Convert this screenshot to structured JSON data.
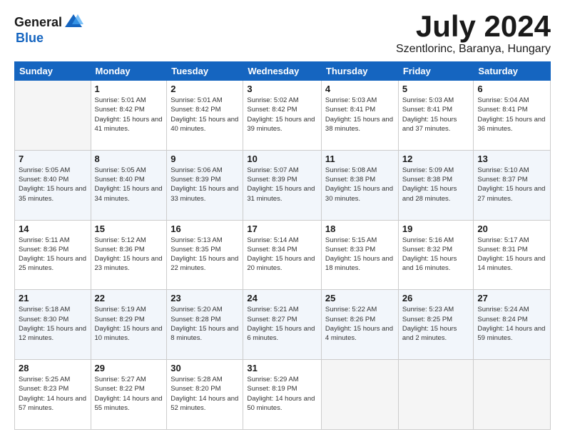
{
  "logo": {
    "general": "General",
    "blue": "Blue"
  },
  "header": {
    "month": "July 2024",
    "location": "Szentlorinc, Baranya, Hungary"
  },
  "weekdays": [
    "Sunday",
    "Monday",
    "Tuesday",
    "Wednesday",
    "Thursday",
    "Friday",
    "Saturday"
  ],
  "weeks": [
    [
      {
        "day": "",
        "sunrise": "",
        "sunset": "",
        "daylight": ""
      },
      {
        "day": "1",
        "sunrise": "Sunrise: 5:01 AM",
        "sunset": "Sunset: 8:42 PM",
        "daylight": "Daylight: 15 hours and 41 minutes."
      },
      {
        "day": "2",
        "sunrise": "Sunrise: 5:01 AM",
        "sunset": "Sunset: 8:42 PM",
        "daylight": "Daylight: 15 hours and 40 minutes."
      },
      {
        "day": "3",
        "sunrise": "Sunrise: 5:02 AM",
        "sunset": "Sunset: 8:42 PM",
        "daylight": "Daylight: 15 hours and 39 minutes."
      },
      {
        "day": "4",
        "sunrise": "Sunrise: 5:03 AM",
        "sunset": "Sunset: 8:41 PM",
        "daylight": "Daylight: 15 hours and 38 minutes."
      },
      {
        "day": "5",
        "sunrise": "Sunrise: 5:03 AM",
        "sunset": "Sunset: 8:41 PM",
        "daylight": "Daylight: 15 hours and 37 minutes."
      },
      {
        "day": "6",
        "sunrise": "Sunrise: 5:04 AM",
        "sunset": "Sunset: 8:41 PM",
        "daylight": "Daylight: 15 hours and 36 minutes."
      }
    ],
    [
      {
        "day": "7",
        "sunrise": "Sunrise: 5:05 AM",
        "sunset": "Sunset: 8:40 PM",
        "daylight": "Daylight: 15 hours and 35 minutes."
      },
      {
        "day": "8",
        "sunrise": "Sunrise: 5:05 AM",
        "sunset": "Sunset: 8:40 PM",
        "daylight": "Daylight: 15 hours and 34 minutes."
      },
      {
        "day": "9",
        "sunrise": "Sunrise: 5:06 AM",
        "sunset": "Sunset: 8:39 PM",
        "daylight": "Daylight: 15 hours and 33 minutes."
      },
      {
        "day": "10",
        "sunrise": "Sunrise: 5:07 AM",
        "sunset": "Sunset: 8:39 PM",
        "daylight": "Daylight: 15 hours and 31 minutes."
      },
      {
        "day": "11",
        "sunrise": "Sunrise: 5:08 AM",
        "sunset": "Sunset: 8:38 PM",
        "daylight": "Daylight: 15 hours and 30 minutes."
      },
      {
        "day": "12",
        "sunrise": "Sunrise: 5:09 AM",
        "sunset": "Sunset: 8:38 PM",
        "daylight": "Daylight: 15 hours and 28 minutes."
      },
      {
        "day": "13",
        "sunrise": "Sunrise: 5:10 AM",
        "sunset": "Sunset: 8:37 PM",
        "daylight": "Daylight: 15 hours and 27 minutes."
      }
    ],
    [
      {
        "day": "14",
        "sunrise": "Sunrise: 5:11 AM",
        "sunset": "Sunset: 8:36 PM",
        "daylight": "Daylight: 15 hours and 25 minutes."
      },
      {
        "day": "15",
        "sunrise": "Sunrise: 5:12 AM",
        "sunset": "Sunset: 8:36 PM",
        "daylight": "Daylight: 15 hours and 23 minutes."
      },
      {
        "day": "16",
        "sunrise": "Sunrise: 5:13 AM",
        "sunset": "Sunset: 8:35 PM",
        "daylight": "Daylight: 15 hours and 22 minutes."
      },
      {
        "day": "17",
        "sunrise": "Sunrise: 5:14 AM",
        "sunset": "Sunset: 8:34 PM",
        "daylight": "Daylight: 15 hours and 20 minutes."
      },
      {
        "day": "18",
        "sunrise": "Sunrise: 5:15 AM",
        "sunset": "Sunset: 8:33 PM",
        "daylight": "Daylight: 15 hours and 18 minutes."
      },
      {
        "day": "19",
        "sunrise": "Sunrise: 5:16 AM",
        "sunset": "Sunset: 8:32 PM",
        "daylight": "Daylight: 15 hours and 16 minutes."
      },
      {
        "day": "20",
        "sunrise": "Sunrise: 5:17 AM",
        "sunset": "Sunset: 8:31 PM",
        "daylight": "Daylight: 15 hours and 14 minutes."
      }
    ],
    [
      {
        "day": "21",
        "sunrise": "Sunrise: 5:18 AM",
        "sunset": "Sunset: 8:30 PM",
        "daylight": "Daylight: 15 hours and 12 minutes."
      },
      {
        "day": "22",
        "sunrise": "Sunrise: 5:19 AM",
        "sunset": "Sunset: 8:29 PM",
        "daylight": "Daylight: 15 hours and 10 minutes."
      },
      {
        "day": "23",
        "sunrise": "Sunrise: 5:20 AM",
        "sunset": "Sunset: 8:28 PM",
        "daylight": "Daylight: 15 hours and 8 minutes."
      },
      {
        "day": "24",
        "sunrise": "Sunrise: 5:21 AM",
        "sunset": "Sunset: 8:27 PM",
        "daylight": "Daylight: 15 hours and 6 minutes."
      },
      {
        "day": "25",
        "sunrise": "Sunrise: 5:22 AM",
        "sunset": "Sunset: 8:26 PM",
        "daylight": "Daylight: 15 hours and 4 minutes."
      },
      {
        "day": "26",
        "sunrise": "Sunrise: 5:23 AM",
        "sunset": "Sunset: 8:25 PM",
        "daylight": "Daylight: 15 hours and 2 minutes."
      },
      {
        "day": "27",
        "sunrise": "Sunrise: 5:24 AM",
        "sunset": "Sunset: 8:24 PM",
        "daylight": "Daylight: 14 hours and 59 minutes."
      }
    ],
    [
      {
        "day": "28",
        "sunrise": "Sunrise: 5:25 AM",
        "sunset": "Sunset: 8:23 PM",
        "daylight": "Daylight: 14 hours and 57 minutes."
      },
      {
        "day": "29",
        "sunrise": "Sunrise: 5:27 AM",
        "sunset": "Sunset: 8:22 PM",
        "daylight": "Daylight: 14 hours and 55 minutes."
      },
      {
        "day": "30",
        "sunrise": "Sunrise: 5:28 AM",
        "sunset": "Sunset: 8:20 PM",
        "daylight": "Daylight: 14 hours and 52 minutes."
      },
      {
        "day": "31",
        "sunrise": "Sunrise: 5:29 AM",
        "sunset": "Sunset: 8:19 PM",
        "daylight": "Daylight: 14 hours and 50 minutes."
      },
      {
        "day": "",
        "sunrise": "",
        "sunset": "",
        "daylight": ""
      },
      {
        "day": "",
        "sunrise": "",
        "sunset": "",
        "daylight": ""
      },
      {
        "day": "",
        "sunrise": "",
        "sunset": "",
        "daylight": ""
      }
    ]
  ]
}
